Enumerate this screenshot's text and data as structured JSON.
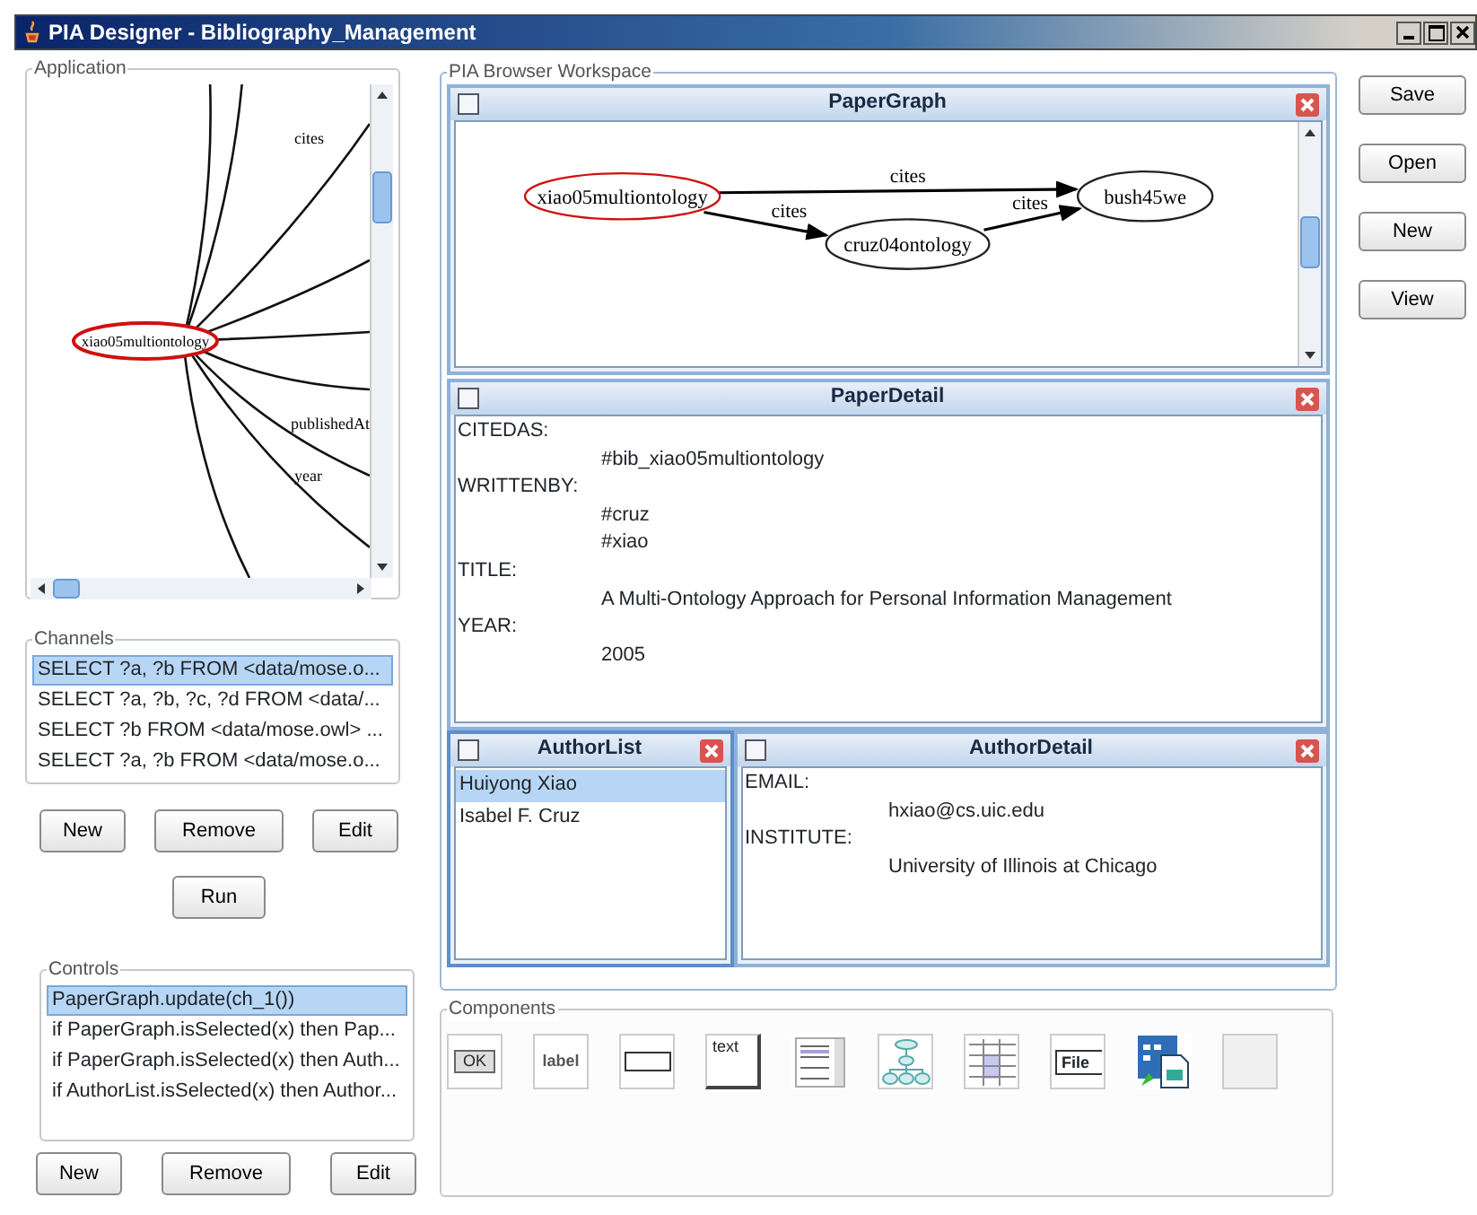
{
  "window": {
    "title": "PIA Designer - Bibliography_Management"
  },
  "application": {
    "title": "Application",
    "center": "xiao05multiontology",
    "edge_labels": [
      "cites",
      "publishedAt",
      "year"
    ]
  },
  "channels": {
    "title": "Channels",
    "items": [
      {
        "text": "SELECT ?a, ?b FROM <data/mose.o...",
        "selected": true
      },
      {
        "text": "SELECT ?a, ?b, ?c, ?d FROM <data/...",
        "selected": false
      },
      {
        "text": "SELECT ?b FROM <data/mose.owl> ...",
        "selected": false
      },
      {
        "text": "SELECT ?a, ?b FROM <data/mose.o...",
        "selected": false
      }
    ],
    "buttons": [
      "New",
      "Remove",
      "Edit"
    ],
    "run": "Run"
  },
  "controls": {
    "title": "Controls",
    "items": [
      {
        "text": "PaperGraph.update(ch_1())",
        "selected": true
      },
      {
        "text": "if PaperGraph.isSelected(x) then Pap...",
        "selected": false
      },
      {
        "text": "if PaperGraph.isSelected(x) then Auth...",
        "selected": false
      },
      {
        "text": "if AuthorList.isSelected(x) then Author...",
        "selected": false
      }
    ],
    "buttons": [
      "New",
      "Remove",
      "Edit"
    ]
  },
  "workspace": {
    "title": "PIA Browser Workspace",
    "paper_graph": {
      "title": "PaperGraph",
      "nodes": [
        {
          "label": "xiao05multiontology",
          "selected": true
        },
        {
          "label": "bush45we",
          "selected": false
        },
        {
          "label": "cruz04ontology",
          "selected": false
        }
      ],
      "edges": [
        {
          "label": "cites"
        },
        {
          "label": "cites"
        },
        {
          "label": "cites"
        }
      ]
    },
    "paper_detail": {
      "title": "PaperDetail",
      "fields": [
        {
          "label": "CITEDAS:",
          "values": [
            "#bib_xiao05multiontology"
          ]
        },
        {
          "label": "WRITTENBY:",
          "values": [
            "#cruz",
            "#xiao"
          ]
        },
        {
          "label": "TITLE:",
          "values": [
            "A Multi-Ontology Approach for Personal Information Management"
          ]
        },
        {
          "label": "YEAR:",
          "values": [
            "2005"
          ]
        }
      ]
    },
    "author_list": {
      "title": "AuthorList",
      "items": [
        {
          "text": "Huiyong Xiao",
          "selected": true
        },
        {
          "text": "Isabel F. Cruz",
          "selected": false
        }
      ]
    },
    "author_detail": {
      "title": "AuthorDetail",
      "fields": [
        {
          "label": "EMAIL:",
          "values": [
            "hxiao@cs.uic.edu"
          ]
        },
        {
          "label": "INSTITUTE:",
          "values": [
            "University of Illinois at Chicago"
          ]
        }
      ]
    }
  },
  "components": {
    "title": "Components",
    "items": [
      {
        "kind": "button",
        "text": "OK"
      },
      {
        "kind": "label",
        "text": "label"
      },
      {
        "kind": "textfield"
      },
      {
        "kind": "textarea",
        "text": "text"
      },
      {
        "kind": "list"
      },
      {
        "kind": "tree"
      },
      {
        "kind": "table"
      },
      {
        "kind": "file",
        "text": "File"
      },
      {
        "kind": "app"
      },
      {
        "kind": "empty"
      }
    ]
  },
  "actions": [
    "Save",
    "Open",
    "New",
    "View"
  ]
}
